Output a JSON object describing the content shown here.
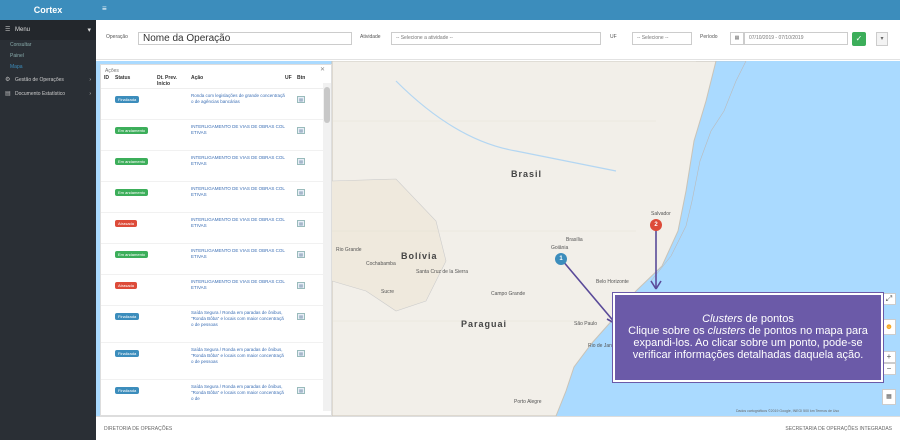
{
  "app": {
    "brand": "Cortex"
  },
  "sidebar": {
    "menu_label": "Menu",
    "sub_items": [
      {
        "label": "Consultar"
      },
      {
        "label": "Painel"
      },
      {
        "label": "Mapa"
      }
    ],
    "sections": [
      {
        "label": "Gestão de Operações"
      },
      {
        "label": "Documento Estatístico"
      }
    ]
  },
  "filters": {
    "operacao_label": "Operação",
    "operacao_value": "Nome da Operação",
    "atividade_label": "Atividade",
    "atividade_value": "-- Selecione a atividade --",
    "uf_label": "UF",
    "uf_value": "-- Selecione --",
    "periodo_label": "Período",
    "periodo_value": "07/10/2019 - 07/10/2019"
  },
  "panel": {
    "title": "Ações",
    "headers": {
      "id": "ID",
      "status": "Status",
      "dt": "Dt. Prev. Início",
      "acao": "Ação",
      "uf": "UF",
      "btn": "Btn"
    },
    "rows": [
      {
        "status": "Finalizada",
        "color": "#3c8dbc",
        "acao": "Ronda com legislações de grande concentração de agências bancárias",
        "tall": false
      },
      {
        "status": "Em andamento",
        "color": "#3cae5a",
        "acao": "INTERLIGAMENTO DE VIAS DE OBRAS COLETIVAS",
        "tall": false
      },
      {
        "status": "Em andamento",
        "color": "#3cae5a",
        "acao": "INTERLIGAMENTO DE VIAS DE OBRAS COLETIVAS",
        "tall": false
      },
      {
        "status": "Em andamento",
        "color": "#3cae5a",
        "acao": "INTERLIGAMENTO DE VIAS DE OBRAS COLETIVAS",
        "tall": false
      },
      {
        "status": "Atrasada",
        "color": "#dd4b39",
        "acao": "INTERLIGAMENTO DE VIAS DE OBRAS COLETIVAS",
        "tall": false
      },
      {
        "status": "Em andamento",
        "color": "#3cae5a",
        "acao": "INTERLIGAMENTO DE VIAS DE OBRAS COLETIVAS",
        "tall": false
      },
      {
        "status": "Atrasada",
        "color": "#dd4b39",
        "acao": "INTERLIGAMENTO DE VIAS DE OBRAS COLETIVAS",
        "tall": false
      },
      {
        "status": "Finalizada",
        "color": "#3c8dbc",
        "acao": "Saída Segura / Ronda em paradas de ônibus, \"Ronda Bôba\" e locais com maior concentração de pessoas",
        "tall": true
      },
      {
        "status": "Finalizada",
        "color": "#3c8dbc",
        "acao": "Saída Segura / Ronda em paradas de ônibus, \"Ronda Bôba\" e locais com maior concentração de pessoas",
        "tall": true
      },
      {
        "status": "Finalizada",
        "color": "#3c8dbc",
        "acao": "Saída Segura / Ronda em paradas de ônibus, \"Ronda Bôba\" e locais com maior concentração de",
        "tall": true
      }
    ]
  },
  "map": {
    "labels": [
      "Brasil",
      "Bolívia",
      "Paraguai",
      "Brasília",
      "Goiânia",
      "Belo Horizonte",
      "Rio de Janeiro",
      "Salvador",
      "São Paulo",
      "Cochabamba",
      "Santa Cruz de la Sierra",
      "Porto Alegre",
      "Campo Grande",
      "Sucre",
      "Rio Grande"
    ],
    "clusters": [
      {
        "count": "1",
        "color": "#3c8dbc"
      },
      {
        "count": "2",
        "color": "#dd4b39"
      }
    ],
    "attribution": "Dados cartográficos ©2019 Google, INEGI   500 km   Termos de Uso"
  },
  "callout": {
    "title_italic": "Clusters",
    "title_rest": " de pontos",
    "line1_a": "Clique sobre os ",
    "line1_i": "clusters",
    "line1_b": " de pontos no mapa para",
    "line2": "expandi-los. Ao clicar sobre um ponto, pode-se",
    "line3": "verificar informações detalhadas daquela ação."
  },
  "footer": {
    "left": "DIRETORIA DE OPERAÇÕES",
    "right": "SECRETARIA DE OPERAÇÕES INTEGRADAS"
  },
  "colors": {
    "accent": "#3c8dbc",
    "sidebar": "#2a2f35",
    "callout": "#6b5aa8",
    "green": "#3cae5a",
    "red": "#dd4b39"
  }
}
